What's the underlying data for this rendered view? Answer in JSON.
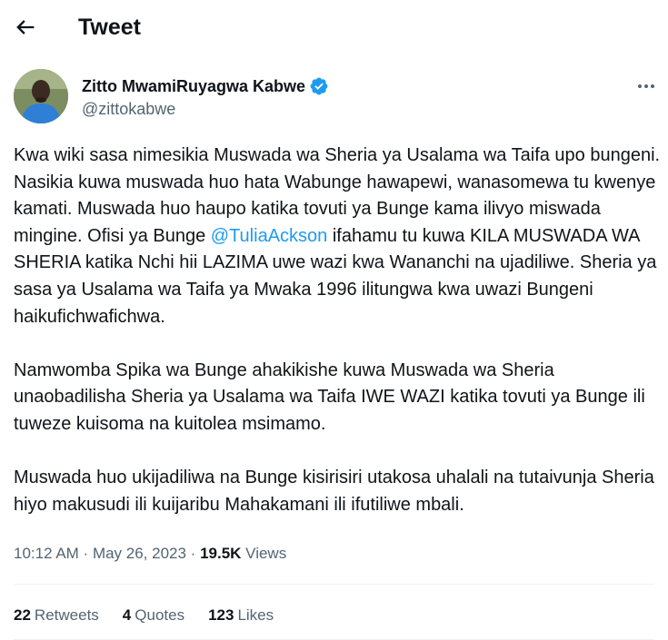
{
  "header": {
    "title": "Tweet"
  },
  "author": {
    "display_name": "Zitto MwamiRuyagwa Kabwe",
    "handle": "@zittokabwe",
    "verified": true
  },
  "tweet": {
    "p1_a": "Kwa wiki sasa nimesikia Muswada wa Sheria ya Usalama wa Taifa upo bungeni. Nasikia kuwa muswada huo hata Wabunge hawapewi, wanasomewa tu kwenye kamati. Muswada huo haupo katika tovuti ya Bunge kama ilivyo miswada mingine. Ofisi ya Bunge ",
    "p1_mention": "@TuliaAckson",
    "p1_b": " ifahamu tu kuwa KILA MUSWADA WA SHERIA katika Nchi hii LAZIMA uwe wazi kwa Wananchi na ujadiliwe. Sheria ya sasa ya Usalama wa Taifa ya Mwaka 1996 ilitungwa kwa uwazi Bungeni haikufichwafichwa.",
    "p2": "Namwomba Spika wa Bunge ahakikishe kuwa Muswada wa Sheria unaobadilisha Sheria ya Usalama wa Taifa IWE WAZI katika tovuti ya Bunge ili tuweze kuisoma na kuitolea msimamo.",
    "p3": "Muswada huo ukijadiliwa na Bunge kisirisiri utakosa uhalali na tutaivunja Sheria hiyo makusudi ili kuijaribu Mahakamani ili ifutiliwe mbali."
  },
  "meta": {
    "time": "10:12 AM",
    "sep": " · ",
    "date": "May 26, 2023",
    "views_count": "19.5K",
    "views_label": "Views"
  },
  "stats": {
    "retweets_count": "22",
    "retweets_label": "Retweets",
    "quotes_count": "4",
    "quotes_label": "Quotes",
    "likes_count": "123",
    "likes_label": "Likes"
  },
  "colors": {
    "accent": "#1d9bf0",
    "secondary_text": "#536471",
    "text": "#0f1419",
    "divider": "#eff3f4"
  },
  "icons": {
    "back": "arrow-left-icon",
    "verified": "verified-badge-icon",
    "more": "more-horizontal-icon"
  }
}
